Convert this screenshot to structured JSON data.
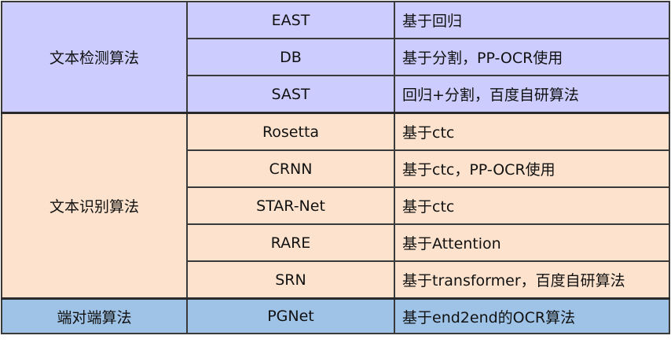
{
  "colors": {
    "detection": "#ccccff",
    "recognition": "#fde3cd",
    "end_to_end": "#9ec3e6",
    "border": "#3a3a3a"
  },
  "groups": [
    {
      "category": "文本检测算法",
      "rows": [
        {
          "algorithm": "EAST",
          "description": "基于回归"
        },
        {
          "algorithm": "DB",
          "description": "基于分割，PP-OCR使用"
        },
        {
          "algorithm": "SAST",
          "description": "回归+分割，百度自研算法"
        }
      ]
    },
    {
      "category": "文本识别算法",
      "rows": [
        {
          "algorithm": "Rosetta",
          "description": "基于ctc"
        },
        {
          "algorithm": "CRNN",
          "description": "基于ctc，PP-OCR使用"
        },
        {
          "algorithm": "STAR-Net",
          "description": "基于ctc"
        },
        {
          "algorithm": "RARE",
          "description": "基于Attention"
        },
        {
          "algorithm": "SRN",
          "description": "基于transformer，百度自研算法"
        }
      ]
    },
    {
      "category": "端对端算法",
      "rows": [
        {
          "algorithm": "PGNet",
          "description": "基于end2end的OCR算法"
        }
      ]
    }
  ]
}
